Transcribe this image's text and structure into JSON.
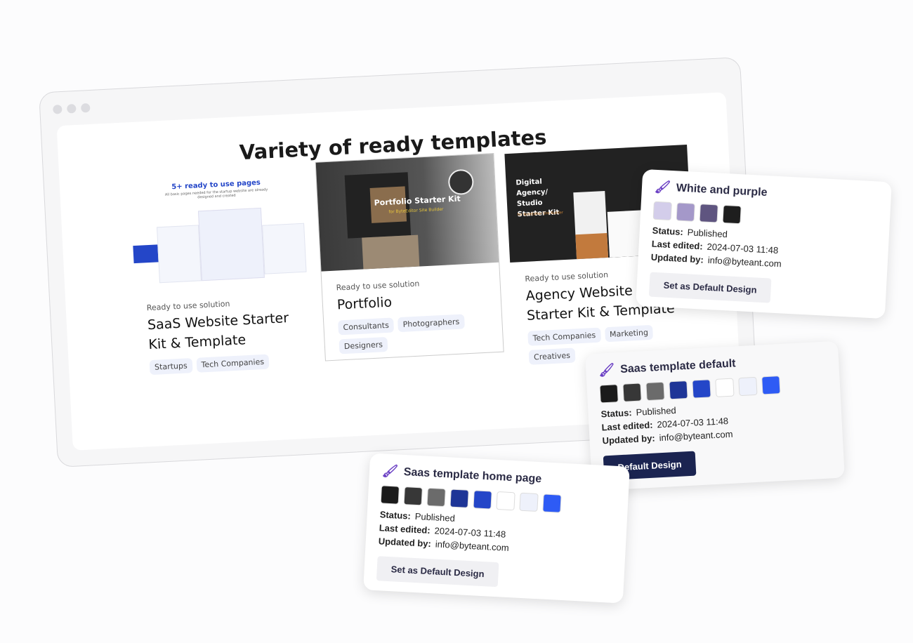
{
  "heading": "Variety of ready templates",
  "templates": [
    {
      "preview_title": "5+ ready to use pages",
      "preview_sub": "All basic pages needed for the startup website are already designed and created",
      "kicker": "Ready to use solution",
      "name": "SaaS Website Starter Kit & Template",
      "tags": [
        "Startups",
        "Tech Companies"
      ]
    },
    {
      "preview_title": "Portfolio Starter Kit",
      "preview_sub": "for ByteEditor Site Builder",
      "kicker": "Ready to use solution",
      "name": "Portfolio",
      "tags": [
        "Consultants",
        "Photographers",
        "Designers"
      ]
    },
    {
      "preview_title": "Digital Agency/ Studio Starter Kit",
      "preview_sub": "for ByteEditor Site Builder",
      "kicker": "Ready to use solution",
      "name": "Agency Website Starter Kit & Template",
      "tags": [
        "Tech Companies",
        "Marketing",
        "Creatives"
      ]
    }
  ],
  "designs": [
    {
      "name": "White and purple",
      "colors": [
        "#d3cdea",
        "#a498c9",
        "#5f5580",
        "#1e1e1e"
      ],
      "status_label": "Status:",
      "status": "Published",
      "edited_label": "Last edited:",
      "edited": "2024-07-03 11:48",
      "by_label": "Updated by:",
      "by": "info@byteant.com",
      "button": "Set as Default Design"
    },
    {
      "name": "Saas template default",
      "colors": [
        "#1b1b1b",
        "#373737",
        "#6b6b6b",
        "#1e3597",
        "#2446c8",
        "#ffffff",
        "#eef1fb",
        "#2e5bf5"
      ],
      "status_label": "Status:",
      "status": "Published",
      "edited_label": "Last edited:",
      "edited": "2024-07-03 11:48",
      "by_label": "Updated by:",
      "by": "info@byteant.com",
      "button": "Default Design"
    },
    {
      "name": "Saas template home page",
      "colors": [
        "#1b1b1b",
        "#373737",
        "#6b6b6b",
        "#1e3597",
        "#2446c8",
        "#ffffff",
        "#eef1fb",
        "#2e5bf5"
      ],
      "status_label": "Status:",
      "status": "Published",
      "edited_label": "Last edited:",
      "edited": "2024-07-03 11:48",
      "by_label": "Updated by:",
      "by": "info@byteant.com",
      "button": "Set as Default Design"
    }
  ],
  "icons": {
    "design": "paintbrush-icon"
  }
}
